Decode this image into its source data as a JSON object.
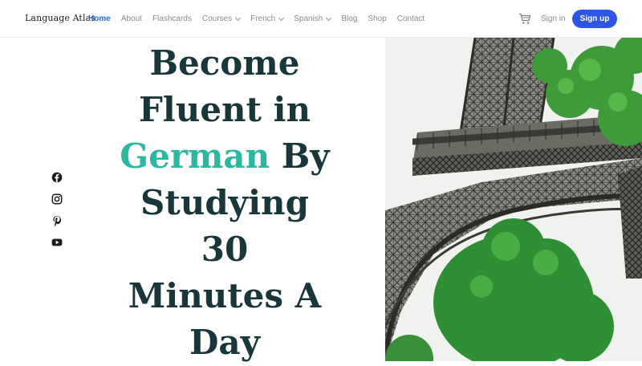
{
  "nav": {
    "logo": "Language Atlas",
    "items": [
      {
        "label": "Home",
        "active": true,
        "dropdown": false
      },
      {
        "label": "About",
        "active": false,
        "dropdown": false
      },
      {
        "label": "Flashcards",
        "active": false,
        "dropdown": false
      },
      {
        "label": "Courses",
        "active": false,
        "dropdown": true
      },
      {
        "label": "French",
        "active": false,
        "dropdown": true
      },
      {
        "label": "Spanish",
        "active": false,
        "dropdown": true
      },
      {
        "label": "Blog",
        "active": false,
        "dropdown": false
      },
      {
        "label": "Shop",
        "active": false,
        "dropdown": false
      },
      {
        "label": "Contact",
        "active": false,
        "dropdown": false
      }
    ],
    "cart_icon": "cart-icon",
    "signin_label": "Sign in",
    "signup_label": "Sign up",
    "accent_color": "#2f55e4"
  },
  "social": [
    "facebook-icon",
    "instagram-icon",
    "pinterest-icon",
    "youtube-icon"
  ],
  "hero": {
    "line1": "Become",
    "line2": "Fluent in",
    "accent_word": "German",
    "line3_rest": " By",
    "line4": "Studying 30",
    "line5": "Minutes A",
    "line6": "Day",
    "accent_color": "#2ab8a0",
    "text_color": "#17373a"
  },
  "image": {
    "subject": "eiffel-tower-with-trees"
  }
}
